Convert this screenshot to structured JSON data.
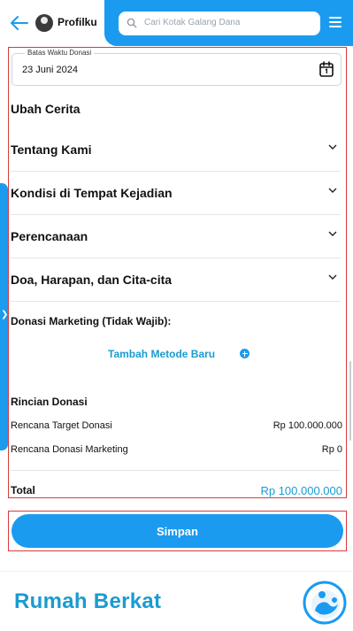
{
  "header": {
    "profile_label": "Profilku",
    "search_placeholder": "Cari Kotak Galang Dana"
  },
  "form": {
    "deadline": {
      "label": "Batas Waktu Donasi",
      "value": "23 Juni 2024"
    },
    "story_heading": "Ubah Cerita",
    "sections": [
      {
        "title": "Tentang Kami"
      },
      {
        "title": "Kondisi di Tempat Kejadian"
      },
      {
        "title": "Perencanaan"
      },
      {
        "title": "Doa, Harapan, dan Cita-cita"
      }
    ],
    "marketing_label": "Donasi Marketing (Tidak Wajib):",
    "add_method_label": "Tambah Metode Baru",
    "summary": {
      "heading": "Rincian Donasi",
      "rows": [
        {
          "label": "Rencana Target Donasi",
          "value": "Rp 100.000.000"
        },
        {
          "label": "Rencana Donasi Marketing",
          "value": "Rp 0"
        }
      ],
      "total_label": "Total",
      "total_value": "Rp 100.000.000"
    }
  },
  "actions": {
    "save_label": "Simpan"
  },
  "footer": {
    "brand": "Rumah Berkat"
  },
  "colors": {
    "primary": "#1a9bf0",
    "accent_text": "#1a9bd0",
    "outline": "#d63b3b"
  }
}
